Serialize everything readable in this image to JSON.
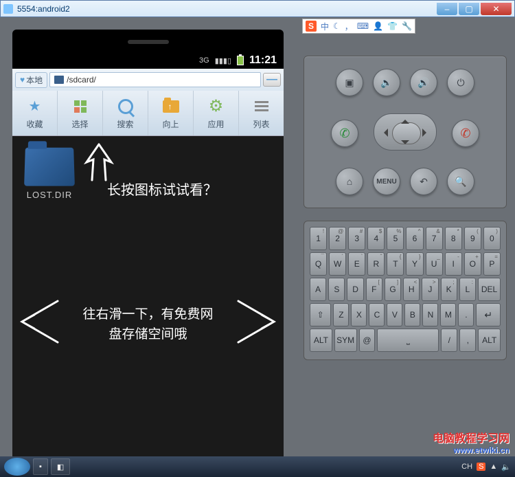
{
  "window": {
    "title": "5554:android2"
  },
  "ime": {
    "brand": "S",
    "lang": "中",
    "icons": [
      "moon",
      "comma",
      "keyboard",
      "person",
      "shirt",
      "wrench"
    ]
  },
  "statusbar": {
    "net": "3G",
    "time": "11:21"
  },
  "addrbar": {
    "home": "本地",
    "path": "/sdcard/",
    "minimize": "—"
  },
  "toolbar": [
    {
      "id": "fav",
      "label": "收藏"
    },
    {
      "id": "select",
      "label": "选择"
    },
    {
      "id": "search",
      "label": "搜索"
    },
    {
      "id": "up",
      "label": "向上"
    },
    {
      "id": "apps",
      "label": "应用"
    },
    {
      "id": "list",
      "label": "列表"
    }
  ],
  "content": {
    "folder": "LOST.DIR",
    "hint1": "长按图标试试看？",
    "hint2_l1": "往右滑一下，有免费网",
    "hint2_l2": "盘存储空间哦"
  },
  "ctrl_buttons": {
    "row1": [
      "camera",
      "vol-down",
      "vol-up",
      "power"
    ],
    "row3": [
      "home",
      "menu",
      "back",
      "search"
    ],
    "menu_label": "MENU"
  },
  "keyboard": {
    "row1": [
      [
        "1",
        "!"
      ],
      [
        "2",
        "@"
      ],
      [
        "3",
        "#"
      ],
      [
        "4",
        "$"
      ],
      [
        "5",
        "%"
      ],
      [
        "6",
        "^"
      ],
      [
        "7",
        "&"
      ],
      [
        "8",
        "*"
      ],
      [
        "9",
        "("
      ],
      [
        "0",
        ")"
      ]
    ],
    "row2": [
      [
        "Q",
        "¯"
      ],
      [
        "W",
        "´"
      ],
      [
        "E",
        "`"
      ],
      [
        "R",
        "ˆ"
      ],
      [
        "T",
        "{"
      ],
      [
        "Y",
        "}"
      ],
      [
        "U",
        "_"
      ],
      [
        "I",
        "-"
      ],
      [
        "O",
        "+"
      ],
      [
        "P",
        "="
      ]
    ],
    "row3": [
      [
        "A",
        ""
      ],
      [
        "S",
        ""
      ],
      [
        "D",
        ""
      ],
      [
        "F",
        "["
      ],
      [
        "G",
        "]"
      ],
      [
        "H",
        "<"
      ],
      [
        "J",
        ">"
      ],
      [
        "K",
        ";"
      ],
      [
        "L",
        ":"
      ],
      [
        "DEL",
        ""
      ]
    ],
    "row4": [
      [
        "⇧",
        ""
      ],
      [
        "Z",
        ""
      ],
      [
        "X",
        ""
      ],
      [
        "C",
        ""
      ],
      [
        "V",
        ""
      ],
      [
        "B",
        ""
      ],
      [
        "N",
        ""
      ],
      [
        "M",
        ""
      ],
      [
        ".",
        ""
      ],
      [
        "↵",
        ""
      ]
    ],
    "row5": [
      "ALT",
      "SYM",
      "@",
      " ",
      "/",
      ",",
      "ALT"
    ]
  },
  "taskbar": {
    "tasks": [
      "cmd",
      "app"
    ],
    "tray_lang": "CH",
    "watermark_cn": "电脑教程学习网",
    "watermark_url": "www.etwiki.cn"
  }
}
